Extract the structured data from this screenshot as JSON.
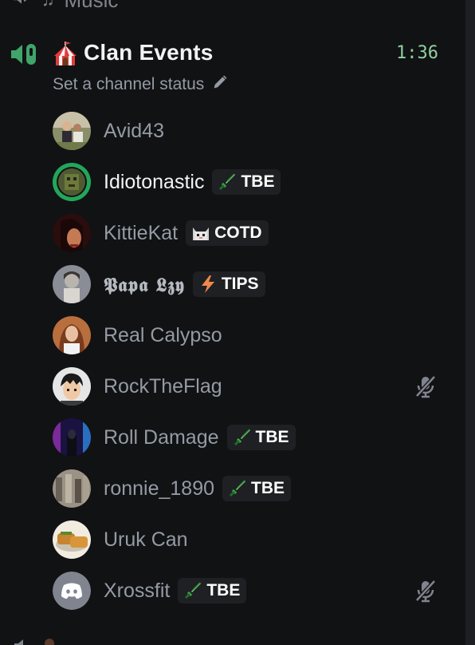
{
  "previous_channel": {
    "label": "Music",
    "icon": "speaker-icon"
  },
  "channel": {
    "icon": "voice-speaking-icon",
    "emoji": "circus-tent",
    "name": "Clan Events",
    "timer": "1:36",
    "status_placeholder": "Set a channel status",
    "status_icon": "pencil-icon"
  },
  "members": [
    {
      "name": "Avid43",
      "active": false,
      "tag": null,
      "muted": false
    },
    {
      "name": "Idiotonastic",
      "active": true,
      "speaking": true,
      "tag": {
        "icon": "sword-icon",
        "text": "TBE"
      },
      "muted": false
    },
    {
      "name": "KittieKat",
      "active": false,
      "tag": {
        "icon": "cat-icon",
        "text": "COTD"
      },
      "muted": false
    },
    {
      "name": "𝕻𝖆𝖕𝖆 𝕷𝖟𝖞",
      "active": false,
      "tag": {
        "icon": "lightning-icon",
        "text": "TIPS"
      },
      "muted": false
    },
    {
      "name": "Real Calypso",
      "active": false,
      "tag": null,
      "muted": false
    },
    {
      "name": "RockTheFlag",
      "active": false,
      "tag": null,
      "muted": true
    },
    {
      "name": "Roll Damage",
      "active": false,
      "tag": {
        "icon": "sword-icon",
        "text": "TBE"
      },
      "muted": false
    },
    {
      "name": "ronnie_1890",
      "active": false,
      "tag": {
        "icon": "sword-icon",
        "text": "TBE"
      },
      "muted": false
    },
    {
      "name": "Uruk Can",
      "active": false,
      "tag": null,
      "muted": false
    },
    {
      "name": "Xrossfit",
      "active": false,
      "tag": {
        "icon": "sword-icon",
        "text": "TBE"
      },
      "muted": true
    }
  ],
  "colors": {
    "background": "#111214",
    "speaking_green": "#23a55a",
    "timer_green": "#8fd19e",
    "muted_text": "#949ba4"
  }
}
